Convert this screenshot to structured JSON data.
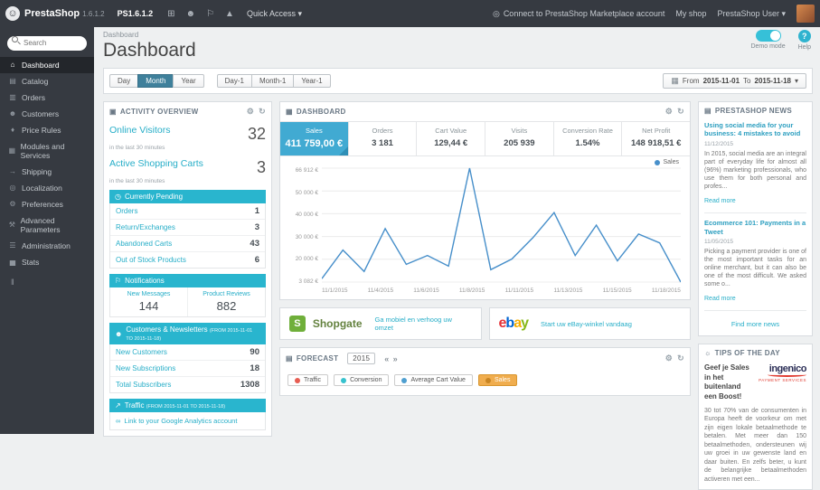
{
  "accent": "#29b5ce",
  "link_color": "#27aec8",
  "topbar": {
    "logo": "PrestaShop",
    "version": "1.6.1.2",
    "shop_name": "PS1.6.1.2",
    "quick_access": "Quick Access ▾",
    "marketplace": "Connect to PrestaShop Marketplace account",
    "my_shop": "My shop",
    "user": "PrestaShop User ▾"
  },
  "icons": {
    "logo": "☺",
    "cart": "⊞",
    "person": "☻",
    "flag": "⚐",
    "rocket": "▲",
    "marketplace": "◎",
    "gear": "⚙",
    "refresh": "↻",
    "calendar": "▦",
    "caret": "▾",
    "clock": "◷",
    "bell": "⚐",
    "users": "☻",
    "traffic": "↗",
    "link": "∞",
    "panel_activity": "▣",
    "panel_dashboard": "▦",
    "panel_forecast": "▤",
    "panel_news": "▤",
    "panel_tips": "☼",
    "collapse": "‖",
    "prev": "«",
    "next": "»",
    "legend_dot": "●"
  },
  "sidebar": {
    "search_placeholder": "Search",
    "items": [
      {
        "label": "Dashboard",
        "icon": "⌂",
        "active": true
      },
      {
        "label": "Catalog",
        "icon": "▤"
      },
      {
        "label": "Orders",
        "icon": "▥"
      },
      {
        "label": "Customers",
        "icon": "☻"
      },
      {
        "label": "Price Rules",
        "icon": "♦"
      },
      {
        "label": "Modules and Services",
        "icon": "▦"
      },
      {
        "label": "Shipping",
        "icon": "→"
      },
      {
        "label": "Localization",
        "icon": "◎"
      },
      {
        "label": "Preferences",
        "icon": "⚙"
      },
      {
        "label": "Advanced Parameters",
        "icon": "⚒"
      },
      {
        "label": "Administration",
        "icon": "☰"
      },
      {
        "label": "Stats",
        "icon": "▅"
      }
    ]
  },
  "header": {
    "breadcrumb": "Dashboard",
    "title": "Dashboard",
    "demo_mode": "Demo mode",
    "help": "Help"
  },
  "filters": {
    "buttons": [
      "Day",
      "Month",
      "Year",
      "Day-1",
      "Month-1",
      "Year-1"
    ],
    "active": "Month",
    "from_label": "From",
    "from": "2015-11-01",
    "to_label": "To",
    "to": "2015-11-18"
  },
  "activity": {
    "title": "Activity overview",
    "online_visitors_label": "Online Visitors",
    "online_visitors": "32",
    "online_visitors_sub": "in the last 30 minutes",
    "carts_label": "Active Shopping Carts",
    "carts": "3",
    "carts_sub": "in the last 30 minutes",
    "pending": {
      "title": "Currently Pending",
      "rows": [
        {
          "label": "Orders",
          "value": "1"
        },
        {
          "label": "Return/Exchanges",
          "value": "3"
        },
        {
          "label": "Abandoned Carts",
          "value": "43"
        },
        {
          "label": "Out of Stock Products",
          "value": "6"
        }
      ]
    },
    "notifications": {
      "title": "Notifications",
      "cols": [
        {
          "label": "New Messages",
          "value": "144"
        },
        {
          "label": "Product Reviews",
          "value": "882"
        }
      ]
    },
    "customers": {
      "title": "Customers & Newsletters",
      "subtitle": "(FROM 2015-11-01 TO 2015-11-18)",
      "rows": [
        {
          "label": "New Customers",
          "value": "90"
        },
        {
          "label": "New Subscriptions",
          "value": "18"
        },
        {
          "label": "Total Subscribers",
          "value": "1308"
        }
      ]
    },
    "traffic": {
      "title": "Traffic",
      "subtitle": "(FROM 2015-11-01 TO 2015-11-18)",
      "link": "Link to your Google Analytics account"
    }
  },
  "dashboard_panel": {
    "title": "Dashboard",
    "kpis": [
      {
        "label": "Sales",
        "value": "411 759,00 €",
        "active": true
      },
      {
        "label": "Orders",
        "value": "3 181"
      },
      {
        "label": "Cart Value",
        "value": "129,44 €"
      },
      {
        "label": "Visits",
        "value": "205 939"
      },
      {
        "label": "Conversion Rate",
        "value": "1.54%"
      },
      {
        "label": "Net Profit",
        "value": "148 918,51 €"
      }
    ],
    "legend": "Sales"
  },
  "chart_data": {
    "type": "line",
    "title": "Sales",
    "legend_position": "top-right",
    "grid": true,
    "ylim": [
      3082,
      66912
    ],
    "y_tick_labels": [
      "66 912 €",
      "50 000 €",
      "40 000 €",
      "30 000 €",
      "20 000 €",
      "3 082 €"
    ],
    "x_tick_labels": [
      "11/1/2015",
      "11/4/2015",
      "11/6/2015",
      "11/8/2015",
      "11/11/2015",
      "11/13/2015",
      "11/15/2015",
      "11/18/2015"
    ],
    "series": [
      {
        "name": "Sales",
        "color": "#478fca",
        "x": [
          "11/1/2015",
          "11/2/2015",
          "11/3/2015",
          "11/4/2015",
          "11/5/2015",
          "11/6/2015",
          "11/7/2015",
          "11/8/2015",
          "11/9/2015",
          "11/10/2015",
          "11/11/2015",
          "11/12/2015",
          "11/13/2015",
          "11/14/2015",
          "11/15/2015",
          "11/16/2015",
          "11/17/2015",
          "11/18/2015"
        ],
        "values": [
          5000,
          21000,
          9000,
          33000,
          13000,
          18000,
          12000,
          66912,
          10000,
          16000,
          28000,
          42000,
          18000,
          35000,
          15000,
          30000,
          25000,
          3082
        ]
      }
    ]
  },
  "ads": {
    "shopgate": {
      "brand": "Shopgate",
      "icon_letter": "S",
      "text": "Ga mobiel en verhoog uw omzet"
    },
    "ebay": {
      "letters": [
        "e",
        "b",
        "a",
        "y"
      ],
      "text": "Start uw eBay-winkel vandaag"
    }
  },
  "forecast": {
    "title": "Forecast",
    "year": "2015",
    "legend": [
      {
        "label": "Traffic",
        "color": "#e75d52"
      },
      {
        "label": "Conversion",
        "color": "#37c2ce"
      },
      {
        "label": "Average Cart Value",
        "color": "#4f9fd0"
      },
      {
        "label": "Sales",
        "color": "#c98523",
        "active": true
      }
    ]
  },
  "news": {
    "title": "PrestaShop News",
    "articles": [
      {
        "headline": "Using social media for your business: 4 mistakes to avoid",
        "date": "11/12/2015",
        "excerpt": "In 2015, social media are an integral part of everyday life for almost all (96%) marketing professionals, who use them for both personal and profes...",
        "read_more": "Read more"
      },
      {
        "headline": "Ecommerce 101: Payments in a Tweet",
        "date": "11/05/2015",
        "excerpt": "Picking a payment provider is one of the most important tasks for an online merchant, but it can also be one of the most difficult. We asked some o...",
        "read_more": "Read more"
      }
    ],
    "find_more": "Find more news"
  },
  "tips": {
    "title": "Tips of the day",
    "headline": "Geef je Sales in het buitenland een Boost!",
    "brand": "ingenico",
    "brand_sub": "Payment services",
    "body": "30 tot 70% van de consumenten in Europa heeft de voorkeur om met zijn eigen lokale betaalmethode te betalen. Met meer dan 150 betaalmethoden, ondersteunen wij uw groei in uw gewenste land en daar buiten. En zelfs beter, u kunt de belangrijke betaalmethoden activeren met een..."
  }
}
